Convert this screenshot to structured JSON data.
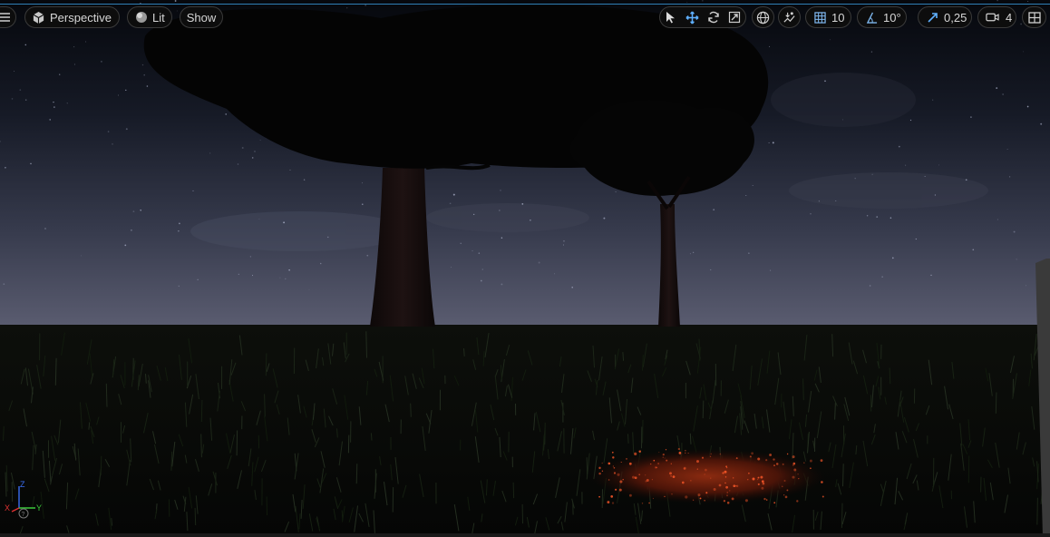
{
  "toolbar": {
    "menu_icon": "hamburger-icon",
    "view_mode": {
      "label": "Perspective",
      "icon": "cube-icon"
    },
    "lighting": {
      "label": "Lit",
      "icon": "sphere-icon"
    },
    "show_label": "Show",
    "transform_tools": [
      "select-arrow-icon",
      "move-icon",
      "rotate-icon",
      "scale-icon"
    ],
    "world_space_icon": "globe-icon",
    "surface_snap_icon": "surface-snap-icon",
    "grid_snap_value": "10",
    "rotation_snap_value": "10°",
    "scale_snap_value": "0,25",
    "camera_speed_value": "4",
    "layout_icon": "viewport-layout-icon"
  },
  "axis_gizmo": {
    "z": "Z",
    "y": "Y",
    "x": "X"
  },
  "colors": {
    "accent": "#2f7fb5",
    "snap_blue": "#9bc7ef",
    "axis_x": "#e03232",
    "axis_y": "#3cc93c",
    "axis_z": "#3a6cf0"
  }
}
